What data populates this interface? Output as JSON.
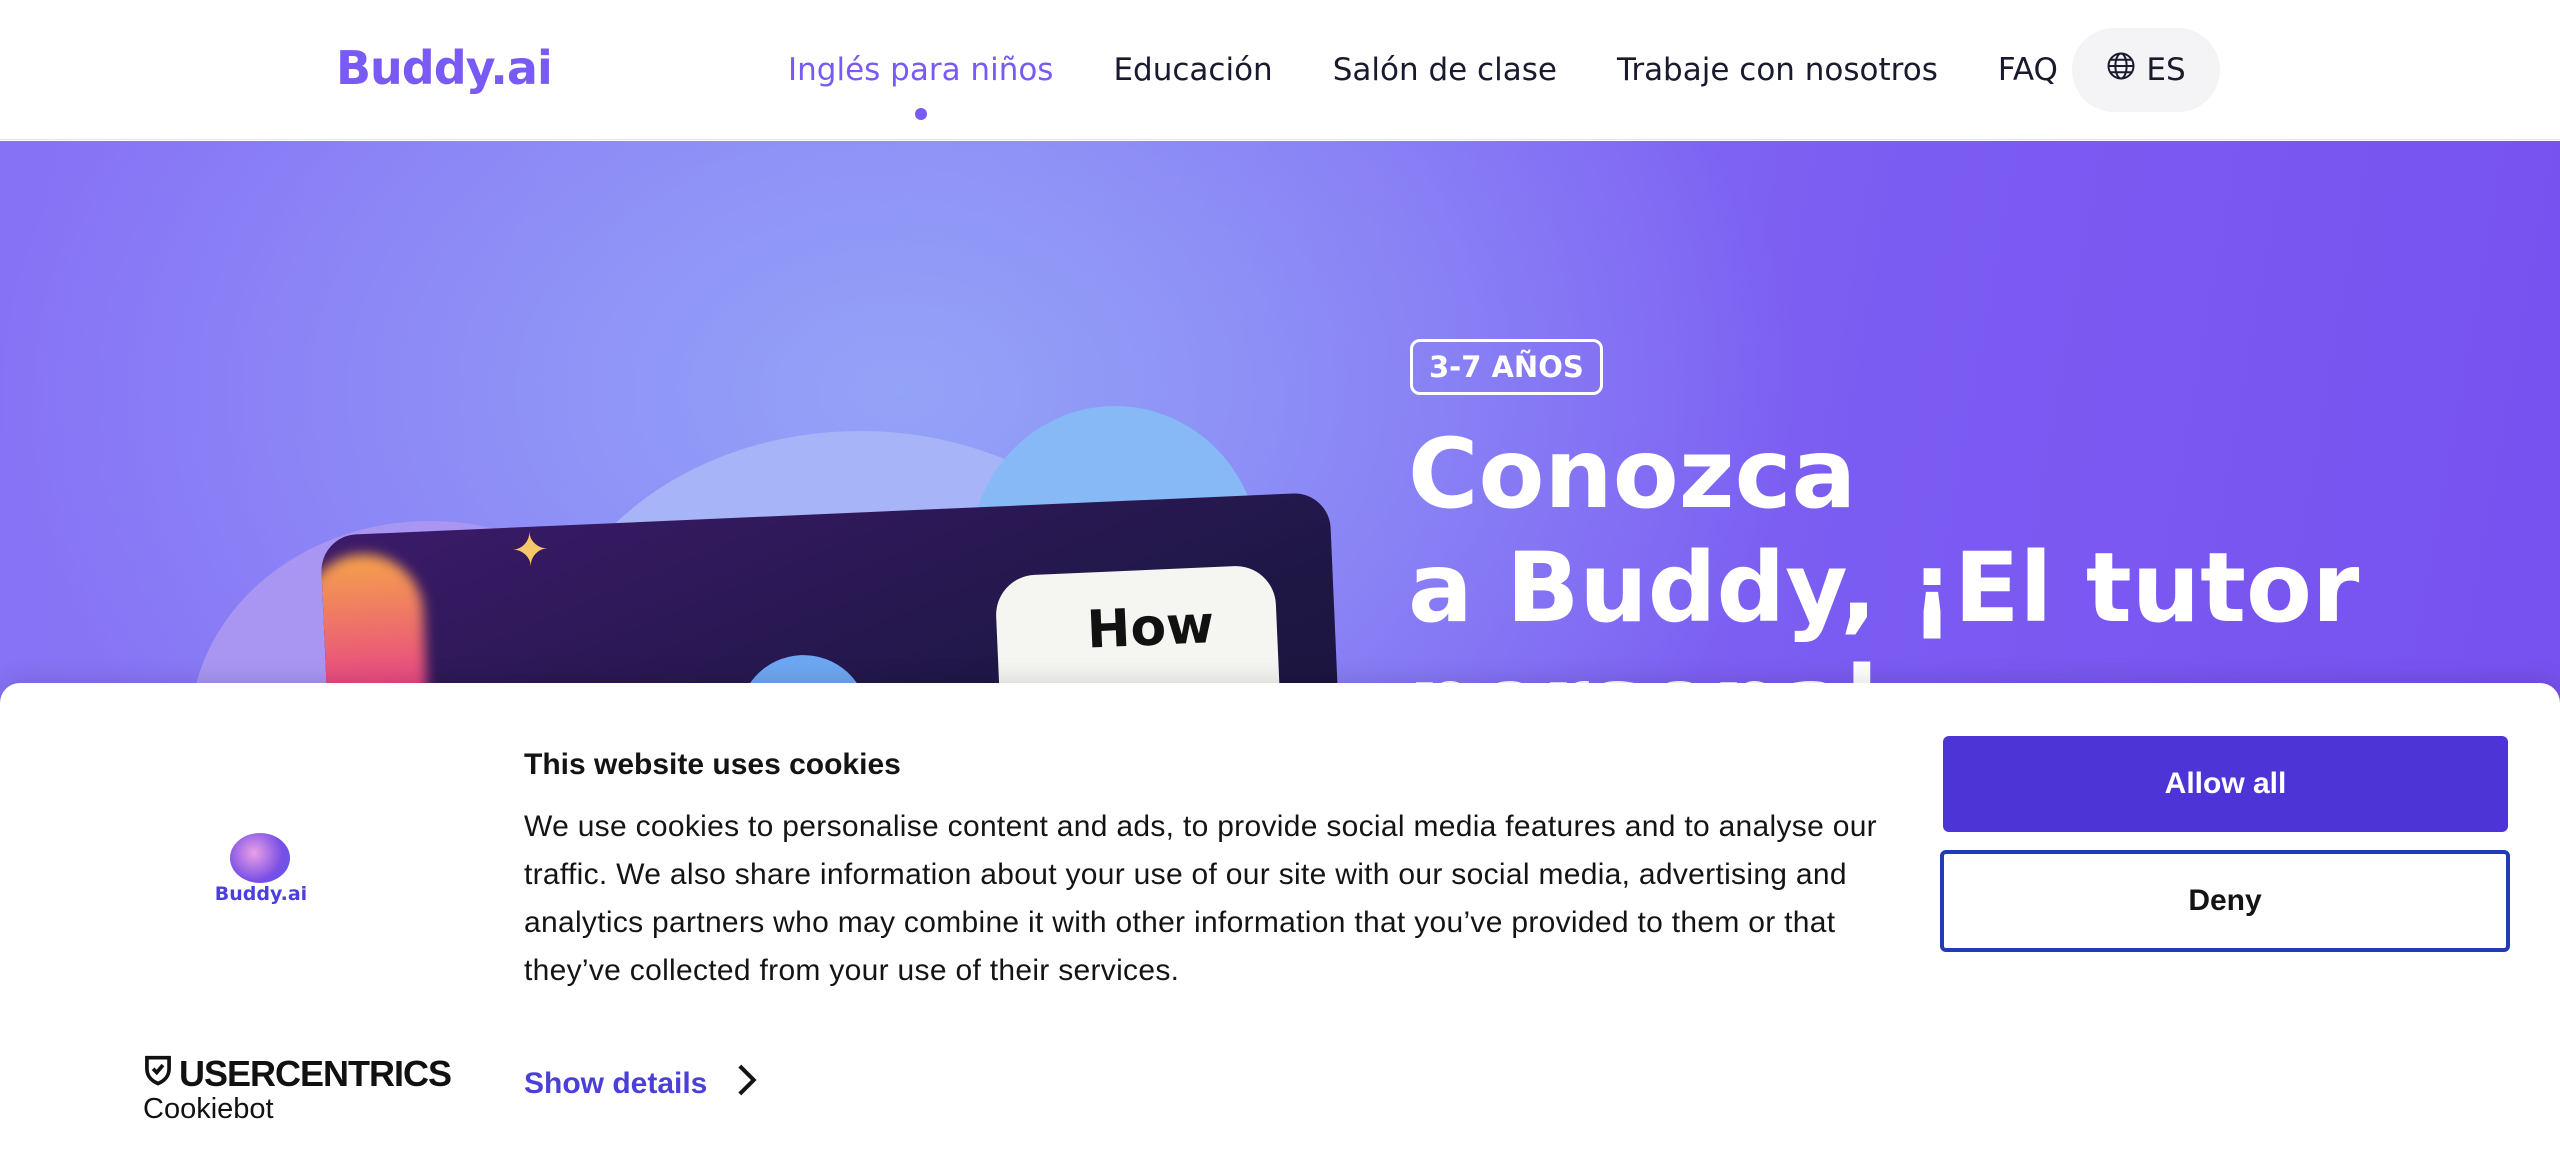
{
  "header": {
    "logo_text": "Buddy.ai",
    "nav": [
      {
        "label": "Inglés para niños",
        "active": true
      },
      {
        "label": "Educación",
        "active": false
      },
      {
        "label": "Salón de clase",
        "active": false
      },
      {
        "label": "Trabaje con nosotros",
        "active": false
      },
      {
        "label": "FAQ",
        "active": false
      }
    ],
    "language": "ES",
    "language_icon": "globe-icon"
  },
  "hero": {
    "age_badge": "3-7 AÑOS",
    "title_lines": [
      "Conozca",
      "a Buddy, ¡El tutor",
      "personal"
    ],
    "video_bubble_text": "How"
  },
  "cookie_banner": {
    "logo_text": "Buddy.ai",
    "title": "This website uses cookies",
    "body": "We use cookies to personalise content and ads, to provide social media features and to analyse our traffic. We also share information about your use of our site with our social media, advertising and analytics partners who may combine it with other information that you’ve provided to them or that they’ve collected from your use of their services.",
    "show_details_label": "Show details",
    "allow_all_label": "Allow all",
    "deny_label": "Deny",
    "provider_name": "USERCENTRICS",
    "provider_sub": "Cookiebot"
  },
  "colors": {
    "brand": "#7a5af5",
    "primary_button": "#4d34d7",
    "deny_border": "#1f3bb5",
    "link": "#4a3fd6"
  }
}
